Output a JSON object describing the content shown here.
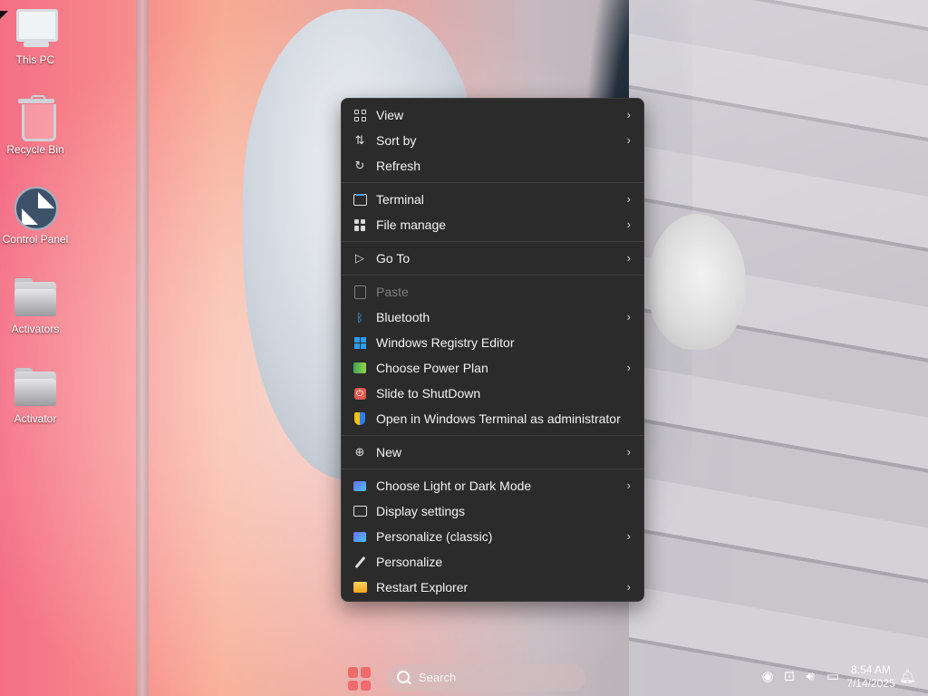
{
  "desktop": {
    "icons": [
      {
        "label": "This PC",
        "icon": "computer-icon"
      },
      {
        "label": "Recycle Bin",
        "icon": "recycle-bin-icon"
      },
      {
        "label": "Control Panel",
        "icon": "control-panel-icon"
      },
      {
        "label": "Activators",
        "icon": "folder-icon"
      },
      {
        "label": "Activator",
        "icon": "folder-icon"
      }
    ]
  },
  "context_menu": {
    "items": [
      {
        "label": "View",
        "icon": "view-grid-icon",
        "submenu": true
      },
      {
        "label": "Sort by",
        "icon": "sort-icon",
        "submenu": true
      },
      {
        "label": "Refresh",
        "icon": "refresh-icon",
        "submenu": false
      },
      {
        "label": "Terminal",
        "icon": "terminal-icon",
        "submenu": true
      },
      {
        "label": "File manage",
        "icon": "file-manage-icon",
        "submenu": true
      },
      {
        "label": "Go To",
        "icon": "cursor-arrow-icon",
        "submenu": true
      },
      {
        "label": "Paste",
        "icon": "paste-icon",
        "submenu": false,
        "disabled": true
      },
      {
        "label": "Bluetooth",
        "icon": "bluetooth-icon",
        "submenu": true
      },
      {
        "label": "Windows Registry Editor",
        "icon": "registry-icon",
        "submenu": false
      },
      {
        "label": "Choose Power Plan",
        "icon": "power-plan-icon",
        "submenu": true
      },
      {
        "label": "Slide to ShutDown",
        "icon": "shutdown-icon",
        "submenu": false
      },
      {
        "label": "Open in Windows Terminal as administrator",
        "icon": "admin-shield-icon",
        "submenu": false
      },
      {
        "label": "New",
        "icon": "new-plus-icon",
        "submenu": true
      },
      {
        "label": "Choose Light or Dark Mode",
        "icon": "theme-monitor-icon",
        "submenu": true
      },
      {
        "label": "Display settings",
        "icon": "display-icon",
        "submenu": false
      },
      {
        "label": "Personalize (classic)",
        "icon": "personalize-classic-icon",
        "submenu": true
      },
      {
        "label": "Personalize",
        "icon": "brush-icon",
        "submenu": false
      },
      {
        "label": "Restart Explorer",
        "icon": "folder-icon",
        "submenu": true
      }
    ],
    "submenu_arrow": "›"
  },
  "taskbar": {
    "search_placeholder": "Search",
    "time": "8:54 AM",
    "date": "7/14/2025"
  },
  "colors": {
    "menu_bg": "#2b2b2b",
    "menu_text": "#f2f2f2",
    "disabled_text": "#7d7d7d",
    "start_accent": "#f26b6b"
  }
}
